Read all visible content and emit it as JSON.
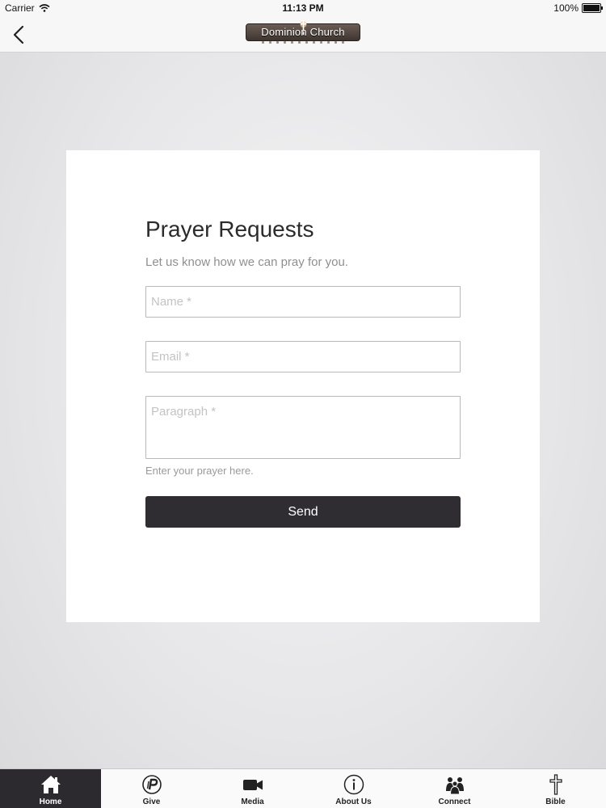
{
  "status_bar": {
    "carrier": "Carrier",
    "time": "11:13 PM",
    "battery": "100%"
  },
  "nav": {
    "logo_text": "Dominion  Church"
  },
  "form": {
    "title": "Prayer Requests",
    "subtitle": "Let us know how we can pray for you.",
    "name_placeholder": "Name *",
    "email_placeholder": "Email *",
    "paragraph_placeholder": "Paragraph *",
    "helper_text": "Enter your prayer here.",
    "send_label": "Send"
  },
  "tabs": [
    {
      "label": "Home",
      "icon": "home-icon",
      "active": true
    },
    {
      "label": "Give",
      "icon": "give-icon",
      "active": false
    },
    {
      "label": "Media",
      "icon": "video-camera-icon",
      "active": false
    },
    {
      "label": "About Us",
      "icon": "info-icon",
      "active": false
    },
    {
      "label": "Connect",
      "icon": "people-group-icon",
      "active": false
    },
    {
      "label": "Bible",
      "icon": "cross-icon",
      "active": false
    }
  ],
  "colors": {
    "accent_dark": "#2f2d31",
    "active_tab": "#2c2a2e"
  }
}
